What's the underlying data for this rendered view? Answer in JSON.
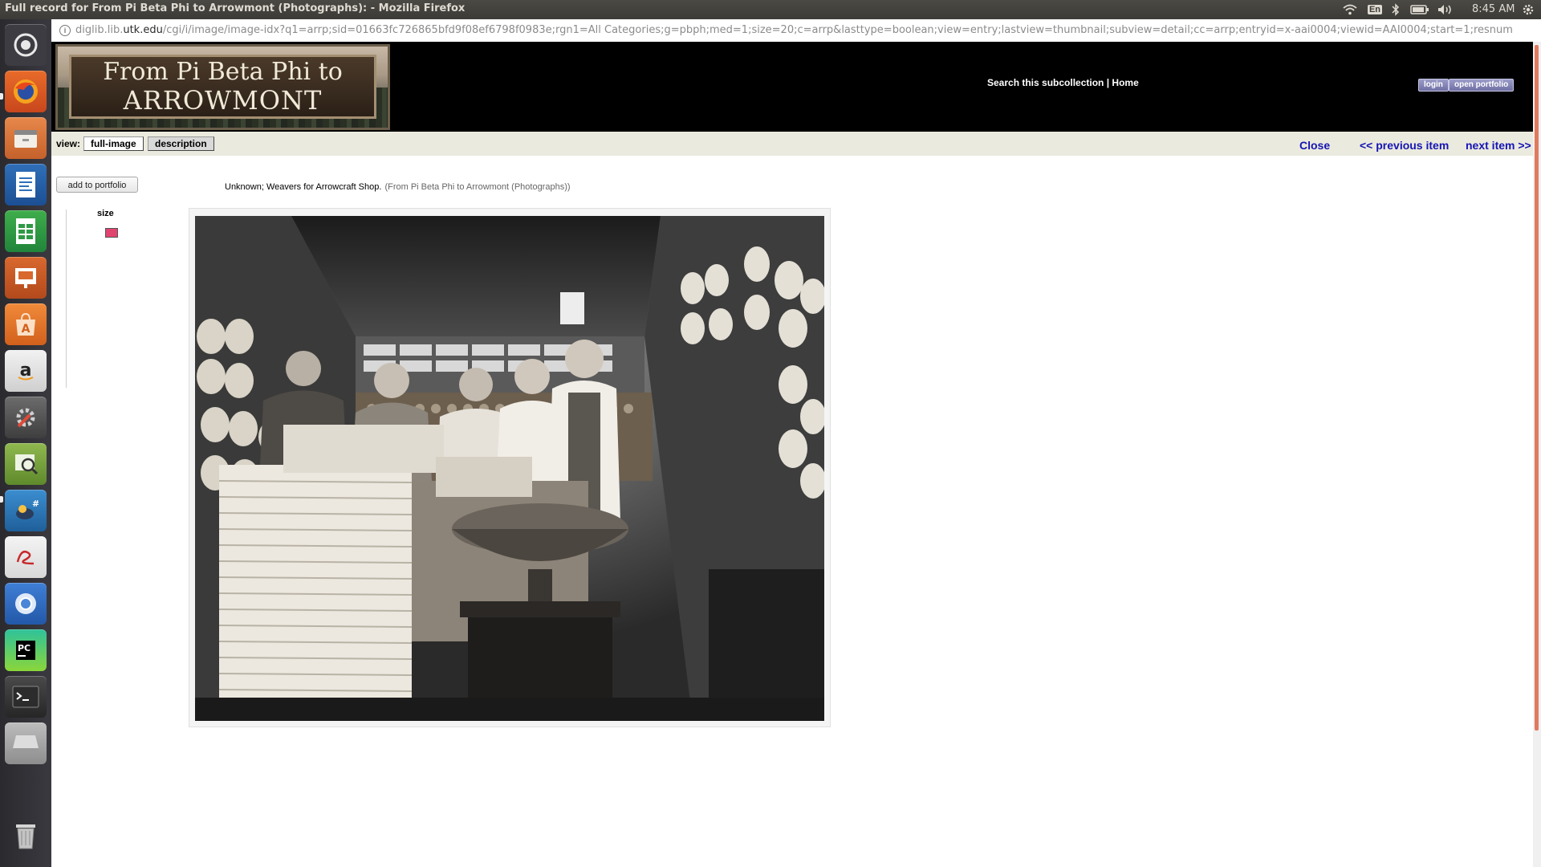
{
  "window": {
    "title": "Full record for From Pi Beta Phi to Arrowmont (Photographs): - Mozilla Firefox",
    "clock": "8:45 AM",
    "keyboard_indicator": "En"
  },
  "launcher": {
    "items": [
      "dash-icon",
      "firefox-icon",
      "files-icon",
      "writer-icon",
      "calc-icon",
      "impress-icon",
      "software-center-icon",
      "amazon-icon",
      "settings-icon",
      "image-viewer-icon",
      "mail-icon",
      "document-viewer-icon",
      "chromium-icon",
      "pycharm-icon",
      "terminal-icon",
      "drive-icon",
      "trash-icon"
    ]
  },
  "browser": {
    "url_prefix": "diglib.lib.",
    "url_host": "utk.edu",
    "url_path": "/cgi/i/image/image-idx?q1=arrp;sid=01663fc726865bfd9f08ef6798f0983e;rgn1=All Categories;g=pbph;med=1;size=20;c=arrp&lasttype=boolean;view=entry;lastview=thumbnail;subview=detail;cc=arrp;entryid=x-aai0004;viewid=AAI0004;start=1;resnum"
  },
  "header": {
    "banner_line1": "From Pi Beta Phi to",
    "banner_line2": "ARROWMONT",
    "search_link": "Search this subcollection",
    "separator": " | ",
    "home_link": "Home",
    "login_button": "login",
    "portfolio_button": "open portfolio"
  },
  "viewbar": {
    "label": "view:",
    "full_image": "full-image",
    "description": "description",
    "close": "Close",
    "previous": "<< previous item",
    "next": "next item >>"
  },
  "record": {
    "add_to_portfolio": "add to portfolio",
    "caption": "Unknown; Weavers for Arrowcraft Shop.",
    "caption_source": "(From Pi Beta Phi to Arrowmont (Photographs))",
    "size_label": "size",
    "size_swatch_color": "#e0446f"
  },
  "colors": {
    "link": "#1515b5",
    "header_bg": "#000000",
    "viewbar_bg": "#ebeade"
  }
}
